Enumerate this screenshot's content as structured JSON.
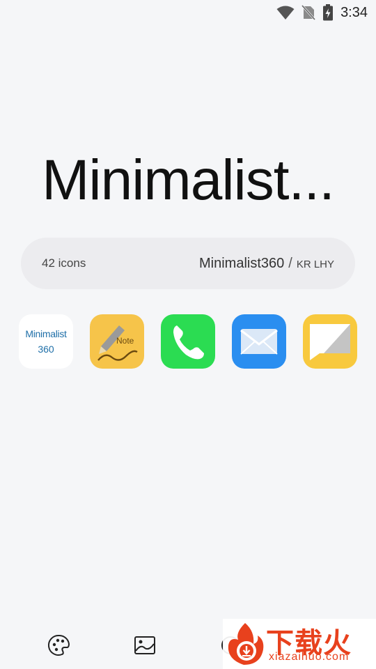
{
  "status_bar": {
    "time": "3:34",
    "icons": [
      "wifi-icon",
      "no-sim-icon",
      "battery-charging-icon"
    ]
  },
  "pack": {
    "title": "Minimalist...",
    "icon_count": "42 icons",
    "name": "Minimalist360",
    "separator": "/",
    "author": "KR LHY"
  },
  "preview_icons": [
    {
      "name": "minimalist360-app-icon",
      "line1": "Minimalist",
      "line2": "360"
    },
    {
      "name": "note-app-icon",
      "label": "Note"
    },
    {
      "name": "phone-app-icon"
    },
    {
      "name": "mail-app-icon"
    },
    {
      "name": "messages-app-icon"
    }
  ],
  "bottom_nav": {
    "icons": [
      "theme-palette-icon",
      "wallpaper-icon",
      "settings-icon"
    ]
  },
  "watermark": {
    "cn": "下载火",
    "en": "xiazaihuo.com"
  },
  "colors": {
    "background": "#f5f6f8",
    "pill": "#ececef",
    "note_yellow": "#f6c44a",
    "phone_green": "#2bdc52",
    "mail_blue": "#2a8ef0",
    "messages_yellow": "#f8c93e",
    "watermark_red": "#e8411d"
  }
}
